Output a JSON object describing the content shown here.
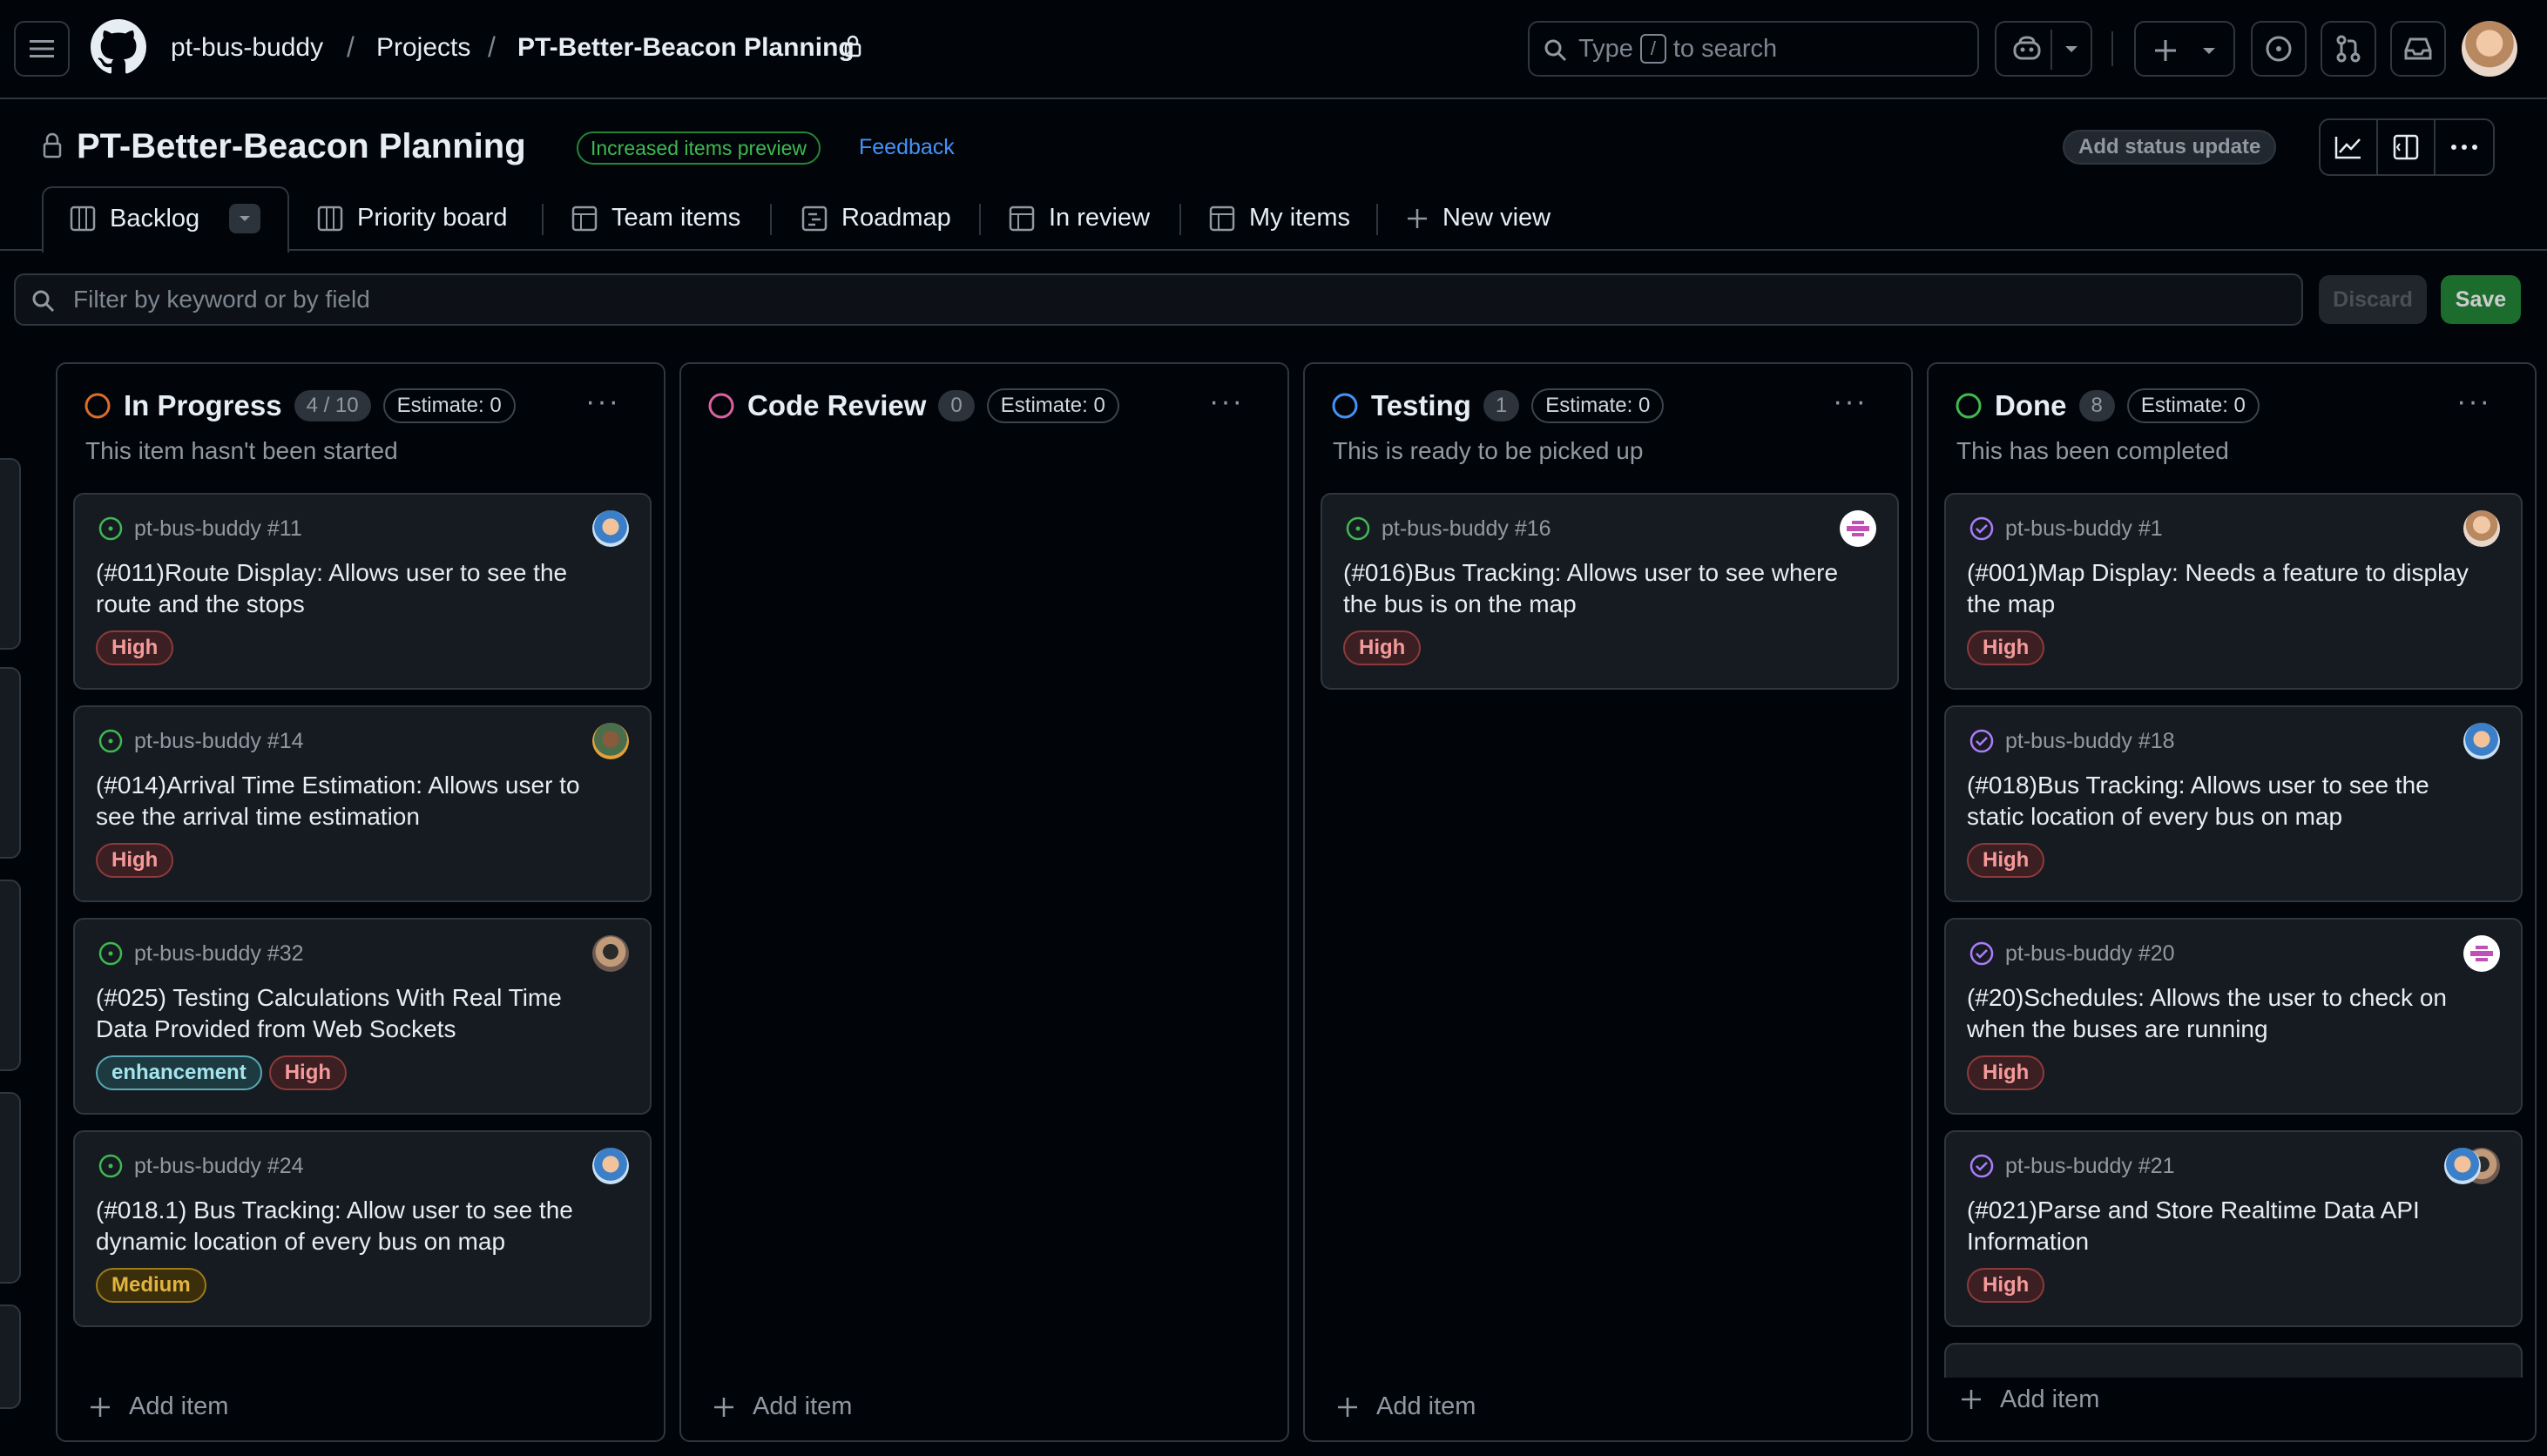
{
  "topbar": {
    "owner": "pt-bus-buddy",
    "projects": "Projects",
    "project": "PT-Better-Beacon Planning",
    "search_prefix": "Type",
    "search_key": "/",
    "search_suffix": "to search"
  },
  "project": {
    "title": "PT-Better-Beacon Planning",
    "preview_badge": "Increased items preview",
    "feedback": "Feedback",
    "status_update": "Add status update"
  },
  "tabs": {
    "backlog": "Backlog",
    "priority_board": "Priority board",
    "team_items": "Team items",
    "roadmap": "Roadmap",
    "in_review": "In review",
    "my_items": "My items",
    "new_view": "New view"
  },
  "filter": {
    "placeholder": "Filter by keyword or by field",
    "discard": "Discard",
    "save": "Save"
  },
  "colors": {
    "in_progress": "#db6d28",
    "code_review": "#db61a2",
    "testing": "#4493f8",
    "done": "#3fb950",
    "open_issue": "#3fb950",
    "closed_issue": "#ab7df8"
  },
  "columns": [
    {
      "title": "In Progress",
      "count": "4 / 10",
      "estimate": "Estimate: 0",
      "description": "This item hasn't been started",
      "add": "Add item",
      "cards": [
        {
          "ref": "pt-bus-buddy #11",
          "title": "(#011)Route Display: Allows user to see the route and the stops",
          "labels": [
            "High"
          ]
        },
        {
          "ref": "pt-bus-buddy #14",
          "title": "(#014)Arrival Time Estimation: Allows user to see the arrival time estimation",
          "labels": [
            "High"
          ]
        },
        {
          "ref": "pt-bus-buddy #32",
          "title": "(#025) Testing Calculations With Real Time Data Provided from Web Sockets",
          "labels": [
            "enhancement",
            "High"
          ]
        },
        {
          "ref": "pt-bus-buddy #24",
          "title": "(#018.1) Bus Tracking: Allow user to see the dynamic location of every bus on map",
          "labels": [
            "Medium"
          ]
        }
      ]
    },
    {
      "title": "Code Review",
      "count": "0",
      "estimate": "Estimate: 0",
      "add": "Add item"
    },
    {
      "title": "Testing",
      "count": "1",
      "estimate": "Estimate: 0",
      "description": "This is ready to be picked up",
      "add": "Add item",
      "cards": [
        {
          "ref": "pt-bus-buddy #16",
          "title": "(#016)Bus Tracking: Allows user to see where the bus is on the map",
          "labels": [
            "High"
          ]
        }
      ]
    },
    {
      "title": "Done",
      "count": "8",
      "estimate": "Estimate: 0",
      "description": "This has been completed",
      "add": "Add item",
      "cards": [
        {
          "ref": "pt-bus-buddy #1",
          "title": "(#001)Map Display: Needs a feature to display the map",
          "labels": [
            "High"
          ]
        },
        {
          "ref": "pt-bus-buddy #18",
          "title": "(#018)Bus Tracking: Allows user to see the static location of every bus on map",
          "labels": [
            "High"
          ]
        },
        {
          "ref": "pt-bus-buddy #20",
          "title": "(#20)Schedules: Allows the user to check on when the buses are running",
          "labels": [
            "High"
          ]
        },
        {
          "ref": "pt-bus-buddy #21",
          "title": "(#021)Parse and Store Realtime Data API Information",
          "labels": [
            "High"
          ]
        }
      ]
    }
  ]
}
